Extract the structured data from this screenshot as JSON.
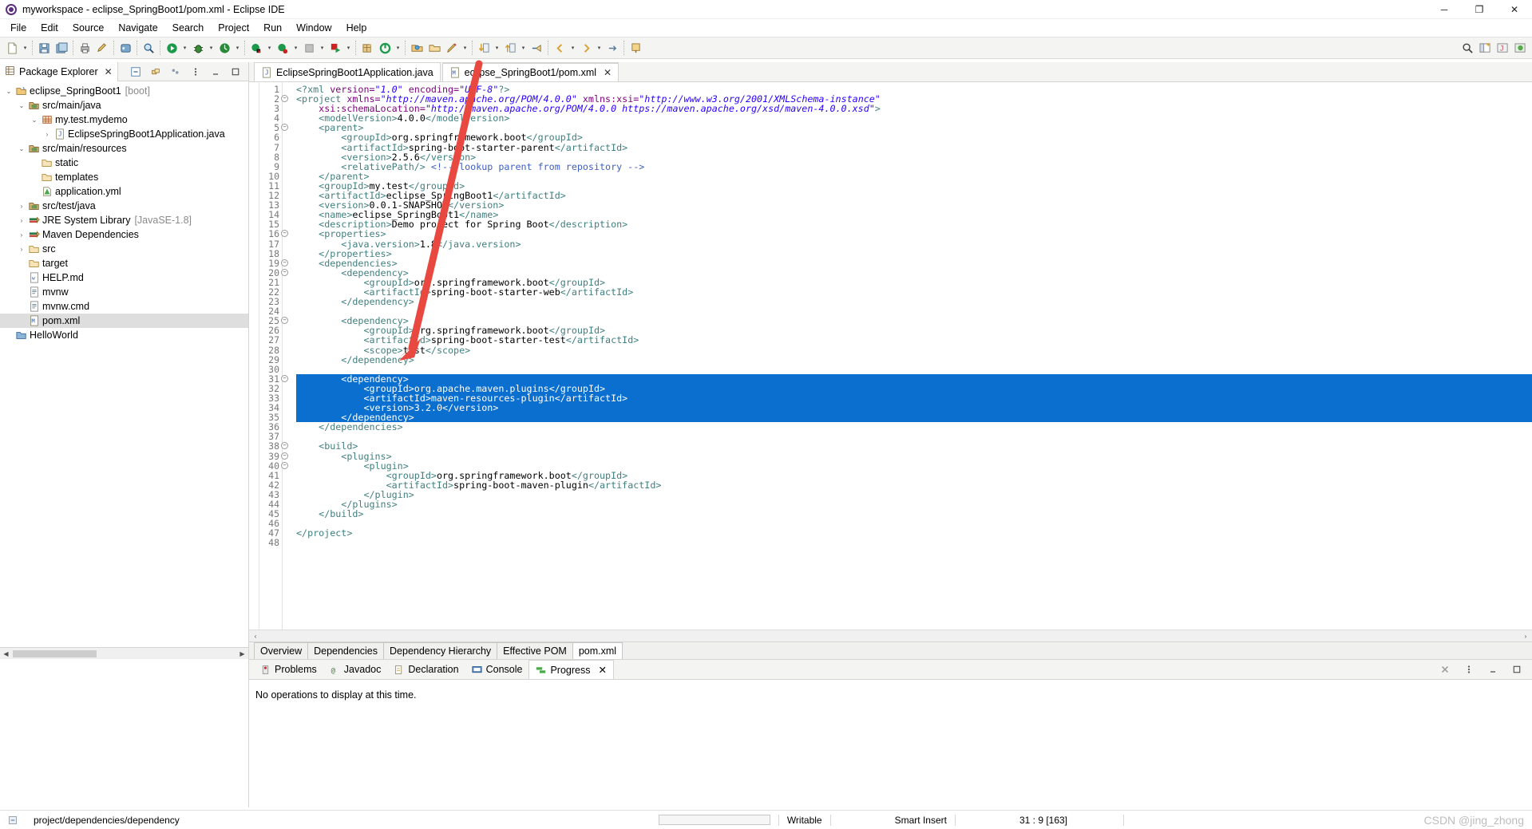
{
  "window": {
    "title": "myworkspace - eclipse_SpringBoot1/pom.xml - Eclipse IDE",
    "app_icon": "eclipse-icon",
    "minimize": "─",
    "maximize": "❐",
    "close": "✕"
  },
  "menubar": {
    "items": [
      "File",
      "Edit",
      "Source",
      "Navigate",
      "Search",
      "Project",
      "Run",
      "Window",
      "Help"
    ]
  },
  "package_explorer": {
    "tab_label": "Package Explorer",
    "close": "✕",
    "tree": [
      {
        "indent": 0,
        "twist": "⌄",
        "icon": "project-icon",
        "label": "eclipse_SpringBoot1",
        "dim": "[boot]",
        "selected": false
      },
      {
        "indent": 1,
        "twist": "⌄",
        "icon": "source-folder-icon",
        "label": "src/main/java",
        "dim": "",
        "selected": false
      },
      {
        "indent": 2,
        "twist": "⌄",
        "icon": "package-icon",
        "label": "my.test.mydemo",
        "dim": "",
        "selected": false
      },
      {
        "indent": 3,
        "twist": "›",
        "icon": "java-file-icon",
        "label": "EclipseSpringBoot1Application.java",
        "dim": "",
        "selected": false
      },
      {
        "indent": 1,
        "twist": "⌄",
        "icon": "source-folder-icon",
        "label": "src/main/resources",
        "dim": "",
        "selected": false
      },
      {
        "indent": 2,
        "twist": "",
        "icon": "folder-icon",
        "label": "static",
        "dim": "",
        "selected": false
      },
      {
        "indent": 2,
        "twist": "",
        "icon": "folder-icon",
        "label": "templates",
        "dim": "",
        "selected": false
      },
      {
        "indent": 2,
        "twist": "",
        "icon": "yml-file-icon",
        "label": "application.yml",
        "dim": "",
        "selected": false
      },
      {
        "indent": 1,
        "twist": "›",
        "icon": "source-folder-icon",
        "label": "src/test/java",
        "dim": "",
        "selected": false
      },
      {
        "indent": 1,
        "twist": "›",
        "icon": "library-icon",
        "label": "JRE System Library",
        "dim": "[JavaSE-1.8]",
        "selected": false
      },
      {
        "indent": 1,
        "twist": "›",
        "icon": "library-icon",
        "label": "Maven Dependencies",
        "dim": "",
        "selected": false
      },
      {
        "indent": 1,
        "twist": "›",
        "icon": "folder-icon",
        "label": "src",
        "dim": "",
        "selected": false
      },
      {
        "indent": 1,
        "twist": "",
        "icon": "folder-icon",
        "label": "target",
        "dim": "",
        "selected": false
      },
      {
        "indent": 1,
        "twist": "",
        "icon": "md-file-icon",
        "label": "HELP.md",
        "dim": "",
        "selected": false
      },
      {
        "indent": 1,
        "twist": "",
        "icon": "text-file-icon",
        "label": "mvnw",
        "dim": "",
        "selected": false
      },
      {
        "indent": 1,
        "twist": "",
        "icon": "text-file-icon",
        "label": "mvnw.cmd",
        "dim": "",
        "selected": false
      },
      {
        "indent": 1,
        "twist": "",
        "icon": "pom-file-icon",
        "label": "pom.xml",
        "dim": "",
        "selected": true
      },
      {
        "indent": 0,
        "twist": "",
        "icon": "project-closed-icon",
        "label": "HelloWorld",
        "dim": "",
        "selected": false
      }
    ]
  },
  "editor": {
    "tabs": [
      {
        "label": "EclipseSpringBoot1Application.java",
        "icon": "java-file-icon",
        "active": false,
        "closable": false
      },
      {
        "label": "eclipse_SpringBoot1/pom.xml",
        "icon": "pom-file-icon",
        "active": true,
        "closable": true
      }
    ],
    "close_glyph": "✕",
    "form_tabs": [
      {
        "label": "Overview",
        "active": false
      },
      {
        "label": "Dependencies",
        "active": false
      },
      {
        "label": "Dependency Hierarchy",
        "active": false
      },
      {
        "label": "Effective POM",
        "active": false
      },
      {
        "label": "pom.xml",
        "active": true
      }
    ],
    "lines": [
      {
        "n": 1,
        "fold": false,
        "sel": false,
        "indent": 0,
        "tokens": [
          [
            "tagc",
            "<?xml "
          ],
          [
            "attrn",
            "version="
          ],
          [
            "attrv",
            "\"1.0\""
          ],
          [
            "attrn",
            " encoding="
          ],
          [
            "attrv",
            "\"UTF-8\""
          ],
          [
            "tagc",
            "?>"
          ]
        ]
      },
      {
        "n": 2,
        "fold": true,
        "sel": false,
        "indent": 0,
        "tokens": [
          [
            "tagc",
            "<project "
          ],
          [
            "attrn",
            "xmlns="
          ],
          [
            "attrv",
            "\"http://maven.apache.org/POM/4.0.0\""
          ],
          [
            "attrn",
            " xmlns:xsi="
          ],
          [
            "attrv",
            "\"http://www.w3.org/2001/XMLSchema-instance\""
          ]
        ]
      },
      {
        "n": 3,
        "fold": false,
        "sel": false,
        "indent": 1,
        "tokens": [
          [
            "attrn",
            "xsi:schemaLocation="
          ],
          [
            "attrv",
            "\"http://maven.apache.org/POM/4.0.0 https://maven.apache.org/xsd/maven-4.0.0.xsd\""
          ],
          [
            "tagc",
            ">"
          ]
        ]
      },
      {
        "n": 4,
        "fold": false,
        "sel": false,
        "indent": 1,
        "tokens": [
          [
            "tagc",
            "<modelVersion>"
          ],
          [
            "txtc",
            "4.0.0"
          ],
          [
            "tagc",
            "</modelVersion>"
          ]
        ]
      },
      {
        "n": 5,
        "fold": true,
        "sel": false,
        "indent": 1,
        "tokens": [
          [
            "tagc",
            "<parent>"
          ]
        ]
      },
      {
        "n": 6,
        "fold": false,
        "sel": false,
        "indent": 2,
        "tokens": [
          [
            "tagc",
            "<groupId>"
          ],
          [
            "txtc",
            "org.springframework.boot"
          ],
          [
            "tagc",
            "</groupId>"
          ]
        ]
      },
      {
        "n": 7,
        "fold": false,
        "sel": false,
        "indent": 2,
        "tokens": [
          [
            "tagc",
            "<artifactId>"
          ],
          [
            "txtc",
            "spring-boot-starter-parent"
          ],
          [
            "tagc",
            "</artifactId>"
          ]
        ]
      },
      {
        "n": 8,
        "fold": false,
        "sel": false,
        "indent": 2,
        "tokens": [
          [
            "tagc",
            "<version>"
          ],
          [
            "txtc",
            "2.5.6"
          ],
          [
            "tagc",
            "</version>"
          ]
        ]
      },
      {
        "n": 9,
        "fold": false,
        "sel": false,
        "indent": 2,
        "tokens": [
          [
            "tagc",
            "<relativePath/>"
          ],
          [
            "txtc",
            " "
          ],
          [
            "cmt",
            "<!-- lookup parent from repository -->"
          ]
        ]
      },
      {
        "n": 10,
        "fold": false,
        "sel": false,
        "indent": 1,
        "tokens": [
          [
            "tagc",
            "</parent>"
          ]
        ]
      },
      {
        "n": 11,
        "fold": false,
        "sel": false,
        "indent": 1,
        "tokens": [
          [
            "tagc",
            "<groupId>"
          ],
          [
            "txtc",
            "my.test"
          ],
          [
            "tagc",
            "</groupId>"
          ]
        ]
      },
      {
        "n": 12,
        "fold": false,
        "sel": false,
        "indent": 1,
        "tokens": [
          [
            "tagc",
            "<artifactId>"
          ],
          [
            "txtc",
            "eclipse_SpringBoot1"
          ],
          [
            "tagc",
            "</artifactId>"
          ]
        ]
      },
      {
        "n": 13,
        "fold": false,
        "sel": false,
        "indent": 1,
        "tokens": [
          [
            "tagc",
            "<version>"
          ],
          [
            "txtc",
            "0.0.1-SNAPSHOT"
          ],
          [
            "tagc",
            "</version>"
          ]
        ]
      },
      {
        "n": 14,
        "fold": false,
        "sel": false,
        "indent": 1,
        "tokens": [
          [
            "tagc",
            "<name>"
          ],
          [
            "txtc",
            "eclipse_SpringBoot1"
          ],
          [
            "tagc",
            "</name>"
          ]
        ]
      },
      {
        "n": 15,
        "fold": false,
        "sel": false,
        "indent": 1,
        "tokens": [
          [
            "tagc",
            "<description>"
          ],
          [
            "txtc",
            "Demo project for Spring Boot"
          ],
          [
            "tagc",
            "</description>"
          ]
        ]
      },
      {
        "n": 16,
        "fold": true,
        "sel": false,
        "indent": 1,
        "tokens": [
          [
            "tagc",
            "<properties>"
          ]
        ]
      },
      {
        "n": 17,
        "fold": false,
        "sel": false,
        "indent": 2,
        "tokens": [
          [
            "tagc",
            "<java.version>"
          ],
          [
            "txtc",
            "1.8"
          ],
          [
            "tagc",
            "</java.version>"
          ]
        ]
      },
      {
        "n": 18,
        "fold": false,
        "sel": false,
        "indent": 1,
        "tokens": [
          [
            "tagc",
            "</properties>"
          ]
        ]
      },
      {
        "n": 19,
        "fold": true,
        "sel": false,
        "indent": 1,
        "tokens": [
          [
            "tagc",
            "<dependencies>"
          ]
        ]
      },
      {
        "n": 20,
        "fold": true,
        "sel": false,
        "indent": 2,
        "tokens": [
          [
            "tagc",
            "<dependency>"
          ]
        ]
      },
      {
        "n": 21,
        "fold": false,
        "sel": false,
        "indent": 3,
        "tokens": [
          [
            "tagc",
            "<groupId>"
          ],
          [
            "txtc",
            "org.springframework.boot"
          ],
          [
            "tagc",
            "</groupId>"
          ]
        ]
      },
      {
        "n": 22,
        "fold": false,
        "sel": false,
        "indent": 3,
        "tokens": [
          [
            "tagc",
            "<artifactId>"
          ],
          [
            "txtc",
            "spring-boot-starter-web"
          ],
          [
            "tagc",
            "</artifactId>"
          ]
        ]
      },
      {
        "n": 23,
        "fold": false,
        "sel": false,
        "indent": 2,
        "tokens": [
          [
            "tagc",
            "</dependency>"
          ]
        ]
      },
      {
        "n": 24,
        "fold": false,
        "sel": false,
        "indent": 0,
        "tokens": []
      },
      {
        "n": 25,
        "fold": true,
        "sel": false,
        "indent": 2,
        "tokens": [
          [
            "tagc",
            "<dependency>"
          ]
        ]
      },
      {
        "n": 26,
        "fold": false,
        "sel": false,
        "indent": 3,
        "tokens": [
          [
            "tagc",
            "<groupId>"
          ],
          [
            "txtc",
            "org.springframework.boot"
          ],
          [
            "tagc",
            "</groupId>"
          ]
        ]
      },
      {
        "n": 27,
        "fold": false,
        "sel": false,
        "indent": 3,
        "tokens": [
          [
            "tagc",
            "<artifactId>"
          ],
          [
            "txtc",
            "spring-boot-starter-test"
          ],
          [
            "tagc",
            "</artifactId>"
          ]
        ]
      },
      {
        "n": 28,
        "fold": false,
        "sel": false,
        "indent": 3,
        "tokens": [
          [
            "tagc",
            "<scope>"
          ],
          [
            "txtc",
            "test"
          ],
          [
            "tagc",
            "</scope>"
          ]
        ]
      },
      {
        "n": 29,
        "fold": false,
        "sel": false,
        "indent": 2,
        "tokens": [
          [
            "tagc",
            "</dependency>"
          ]
        ]
      },
      {
        "n": 30,
        "fold": false,
        "sel": false,
        "indent": 0,
        "tokens": []
      },
      {
        "n": 31,
        "fold": true,
        "sel": true,
        "indent": 2,
        "tokens": [
          [
            "tagc",
            "<dependency>"
          ]
        ]
      },
      {
        "n": 32,
        "fold": false,
        "sel": true,
        "indent": 3,
        "tokens": [
          [
            "tagc",
            "<groupId>"
          ],
          [
            "txtc",
            "org.apache.maven.plugins"
          ],
          [
            "tagc",
            "</groupId>"
          ]
        ]
      },
      {
        "n": 33,
        "fold": false,
        "sel": true,
        "indent": 3,
        "tokens": [
          [
            "tagc",
            "<artifactId>"
          ],
          [
            "txtc",
            "maven-resources-plugin"
          ],
          [
            "tagc",
            "</artifactId>"
          ]
        ]
      },
      {
        "n": 34,
        "fold": false,
        "sel": true,
        "indent": 3,
        "tokens": [
          [
            "tagc",
            "<version>"
          ],
          [
            "txtc",
            "3.2.0"
          ],
          [
            "tagc",
            "</version>"
          ]
        ]
      },
      {
        "n": 35,
        "fold": false,
        "sel": true,
        "indent": 2,
        "tokens": [
          [
            "tagc",
            "</dependency>"
          ]
        ]
      },
      {
        "n": 36,
        "fold": false,
        "sel": false,
        "indent": 1,
        "tokens": [
          [
            "tagc",
            "</dependencies>"
          ]
        ]
      },
      {
        "n": 37,
        "fold": false,
        "sel": false,
        "indent": 0,
        "tokens": []
      },
      {
        "n": 38,
        "fold": true,
        "sel": false,
        "indent": 1,
        "tokens": [
          [
            "tagc",
            "<build>"
          ]
        ]
      },
      {
        "n": 39,
        "fold": true,
        "sel": false,
        "indent": 2,
        "tokens": [
          [
            "tagc",
            "<plugins>"
          ]
        ]
      },
      {
        "n": 40,
        "fold": true,
        "sel": false,
        "indent": 3,
        "tokens": [
          [
            "tagc",
            "<plugin>"
          ]
        ]
      },
      {
        "n": 41,
        "fold": false,
        "sel": false,
        "indent": 4,
        "tokens": [
          [
            "tagc",
            "<groupId>"
          ],
          [
            "txtc",
            "org.springframework.boot"
          ],
          [
            "tagc",
            "</groupId>"
          ]
        ]
      },
      {
        "n": 42,
        "fold": false,
        "sel": false,
        "indent": 4,
        "tokens": [
          [
            "tagc",
            "<artifactId>"
          ],
          [
            "txtc",
            "spring-boot-maven-plugin"
          ],
          [
            "tagc",
            "</artifactId>"
          ]
        ]
      },
      {
        "n": 43,
        "fold": false,
        "sel": false,
        "indent": 3,
        "tokens": [
          [
            "tagc",
            "</plugin>"
          ]
        ]
      },
      {
        "n": 44,
        "fold": false,
        "sel": false,
        "indent": 2,
        "tokens": [
          [
            "tagc",
            "</plugins>"
          ]
        ]
      },
      {
        "n": 45,
        "fold": false,
        "sel": false,
        "indent": 1,
        "tokens": [
          [
            "tagc",
            "</build>"
          ]
        ]
      },
      {
        "n": 46,
        "fold": false,
        "sel": false,
        "indent": 0,
        "tokens": []
      },
      {
        "n": 47,
        "fold": false,
        "sel": false,
        "indent": 0,
        "tokens": [
          [
            "tagc",
            "</project>"
          ]
        ]
      },
      {
        "n": 48,
        "fold": false,
        "sel": false,
        "indent": 0,
        "tokens": []
      }
    ]
  },
  "bottom_panel": {
    "tabs": [
      {
        "label": "Problems",
        "icon": "problems-icon",
        "active": false,
        "closable": false
      },
      {
        "label": "Javadoc",
        "icon": "javadoc-icon",
        "active": false,
        "closable": false
      },
      {
        "label": "Declaration",
        "icon": "declaration-icon",
        "active": false,
        "closable": false
      },
      {
        "label": "Console",
        "icon": "console-icon",
        "active": false,
        "closable": false
      },
      {
        "label": "Progress",
        "icon": "progress-icon",
        "active": true,
        "closable": true
      }
    ],
    "close_glyph": "✕",
    "message": "No operations to display at this time."
  },
  "statusbar": {
    "selection_path": "project/dependencies/dependency",
    "writable": "Writable",
    "insert_mode": "Smart Insert",
    "position": "31 : 9 [163]",
    "watermark": "CSDN @jing_zhong"
  },
  "colors": {
    "selection_blue": "#0a6fcf",
    "tag": "#3f7f7f",
    "attr_name": "#7f007f",
    "attr_value": "#2a00ff",
    "comment": "#3f5fbf",
    "annotation_arrow": "#e8483f"
  },
  "annotation": {
    "arrow": "red-arrow-annotation"
  }
}
